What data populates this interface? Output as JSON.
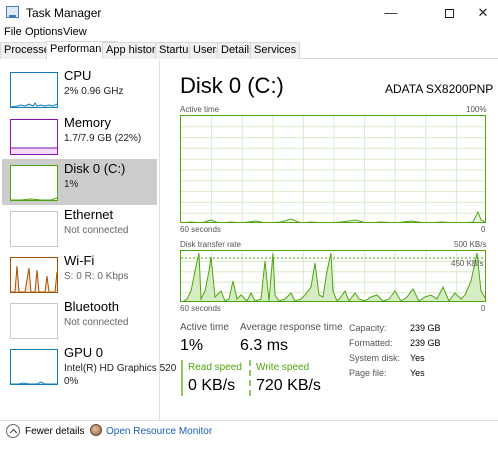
{
  "window": {
    "title": "Task Manager",
    "minimize": "—",
    "close": "✕"
  },
  "menu": [
    "File",
    "Options",
    "View"
  ],
  "tabs": [
    "Processes",
    "Performance",
    "App history",
    "Startup",
    "Users",
    "Details",
    "Services"
  ],
  "active_tab": "Performance",
  "sidebar": {
    "items": [
      {
        "name": "CPU",
        "sub": "2%  0.96 GHz",
        "color": "#117dbb"
      },
      {
        "name": "Memory",
        "sub": "1.7/7.9 GB (22%)",
        "color": "#8b12ae"
      },
      {
        "name": "Disk 0 (C:)",
        "sub": "1%",
        "color": "#4da60c"
      },
      {
        "name": "Ethernet",
        "sub": "Not connected",
        "color": "#a74f01"
      },
      {
        "name": "Wi-Fi",
        "sub": "S: 0  R: 0 Kbps",
        "color": "#a74f01"
      },
      {
        "name": "Bluetooth",
        "sub": "Not connected",
        "color": "#a74f01"
      },
      {
        "name": "GPU 0",
        "sub": "Intel(R) HD Graphics 520",
        "sub2": "0%",
        "color": "#117dbb"
      }
    ]
  },
  "main": {
    "title": "Disk 0 (C:)",
    "model": "ADATA SX8200PNP",
    "active_time_label": "Active time",
    "active_time_max": "100%",
    "active_time_window": "60 seconds",
    "active_time_min": "0",
    "transfer_label": "Disk transfer rate",
    "transfer_max": "500 KB/s",
    "transfer_line": "450 KB/s",
    "transfer_window": "60 seconds",
    "transfer_min": "0",
    "stats": {
      "active_time_label": "Active time",
      "active_time_value": "1%",
      "resp_label": "Average response time",
      "resp_value": "6.3 ms",
      "read_label": "Read speed",
      "read_value": "0 KB/s",
      "write_label": "Write speed",
      "write_value": "720 KB/s"
    },
    "props": [
      {
        "k": "Capacity:",
        "v": "239 GB"
      },
      {
        "k": "Formatted:",
        "v": "239 GB"
      },
      {
        "k": "System disk:",
        "v": "Yes"
      },
      {
        "k": "Page file:",
        "v": "Yes"
      }
    ]
  },
  "footer": {
    "fewer_details": "Fewer details",
    "open_resmon": "Open Resource Monitor"
  },
  "colors": {
    "disk": "#4da60c",
    "disk_fill": "#cfe8b8",
    "selected": "#cccccc",
    "link": "#1a5fb4"
  }
}
